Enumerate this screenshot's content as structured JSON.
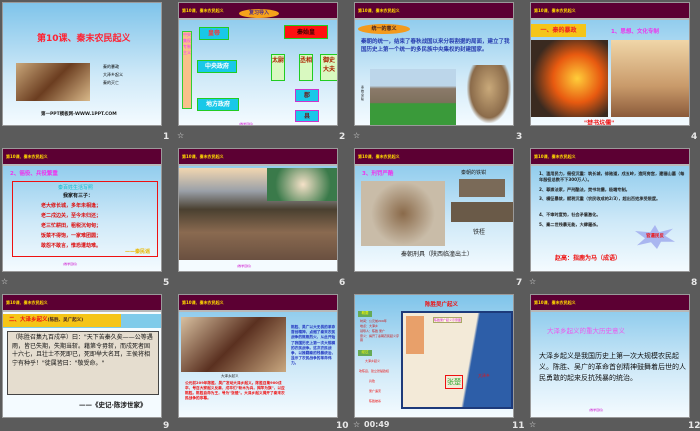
{
  "header_text": "第10课、秦末农民起义",
  "slides": [
    {
      "number": "1",
      "title": "第10课、秦末农民起义",
      "bullets": [
        "秦的暴政",
        "大泽乡起义",
        "秦的灭亡"
      ],
      "footer": "第一PPT模板网-WWW.1PPT.COM"
    },
    {
      "number": "2",
      "badge": "复习导入",
      "emperor": "皇帝",
      "qsh": "秦始皇",
      "central": "中央政府",
      "local": "地方政府",
      "side": "中央集权 专制主义",
      "taiwei": "太尉",
      "chengxiang": "丞相",
      "yushi": "御史大夫",
      "jun": "郡",
      "xian": "县",
      "note": "(教学目标)"
    },
    {
      "number": "3",
      "badge": "统一的意义",
      "text": "秦朝的统一，结束了春秋战国以来分裂割据的局面，建立了我国历史上第一个统一的多民族中央集权的封建国家。",
      "side": "秦始皇陵"
    },
    {
      "number": "4",
      "badge": "一、秦的暴政",
      "sub": "1、思想、文化专制",
      "caption": "\"焚书坑儒\""
    },
    {
      "number": "5",
      "sub": "2、徭役、兵役繁重",
      "poem_title": "秦百姓生活写照",
      "poem": [
        "我家有三子：",
        "老大修长城，多年未相逢；",
        "老二戍边关，至今未归还；",
        "老三忙耕田，租税沉甸甸；",
        "饭菜不得饱，一家难团圆；",
        "敢怨不敢言，惟恐遭劫难。"
      ],
      "signature": "——秦民谣",
      "note": "(教学目标)"
    },
    {
      "number": "6",
      "note": "(教学目标)"
    },
    {
      "number": "7",
      "sub": "3、刑罚严酷",
      "label1": "秦朝的铁钳",
      "label2": "铁桎",
      "caption": "秦朝刑具（陕西临潼出土）"
    },
    {
      "number": "8",
      "items": [
        "1、滥用民力，徭役沉重：筑长城，修驰道，戍五岭，造阿房宫，建骊山墓（每年服役总数不下300万人）。",
        "2、尊崇法家，严刑酷法，焚书坑儒，极端专制。",
        "3、横征暴敛，赋税沉重（农民收成的2/3），超出百姓承受限度。",
        "4、不审时度势，社会矛盾激化。",
        "5、秦二世残暴无能，大肆屠杀。"
      ],
      "star": "官逼民反",
      "bottom": "赵高：指鹿为马（成语）"
    },
    {
      "number": "9",
      "badge": "二、大泽乡起义",
      "badge2": "(陈胜、吴广起义)",
      "quote": "（陈胜召集九百戍卒）曰：\"天下苦秦久矣——公等遇雨，皆已失期，失期当斩。藉第令毋斩，而戍死者固十六七，且壮士不死即已，死即举大名耳，王侯将相宁有种乎！\"徒属皆曰：\"敬受命。\"",
      "source": "——《史记·陈涉世家》"
    },
    {
      "number": "10",
      "img_caption": "大泽乡起义",
      "left": "公元前209年陈胜、吴广发动大泽乡起义。陈胜召集900戍卒，号召大家起义反秦，戍卒们\"斩木为兵，揭竿为旗\"，以应陈胜。陈胜自命为王，号为\"张楚\"。大泽乡起义揭开了秦末农民战争的序幕。",
      "right": "陈胜、吴广以大无畏的革命首创精神，点燃了秦末农民战争的熊熊烈火，从此开始了我国历史上第一次大规模的农民战争。这次农民战争，以推翻秦的残暴统治，显示了农民战争的革命伟力。"
    },
    {
      "number": "11",
      "timing": "00:49",
      "title": "陈胜吴广起义",
      "legend1": "概要",
      "legend2": "经过",
      "facts": [
        "时间：公元前209年",
        "地点：大泽乡",
        "领导人：陈胜 吴广",
        "意义：揭开了秦朝农民起义序幕"
      ],
      "steps": [
        "大泽乡起义",
        "攻陈县，建立张楚政权",
        "兵败",
        "吴广遇害",
        "陈胜被杀"
      ],
      "map_label": "陈胜吴广起义示意图",
      "zhangchu": "张楚",
      "dazexiang": "大泽乡"
    },
    {
      "number": "12",
      "title": "大泽乡起义的重大历史意义",
      "text": "大泽乡起义是我国历史上第一次大规模农民起义。陈胜、吴广的革命首创精神鼓舞着后世的人民勇敢的起来反抗残暴的统治。",
      "note": "(教学目标)"
    }
  ]
}
